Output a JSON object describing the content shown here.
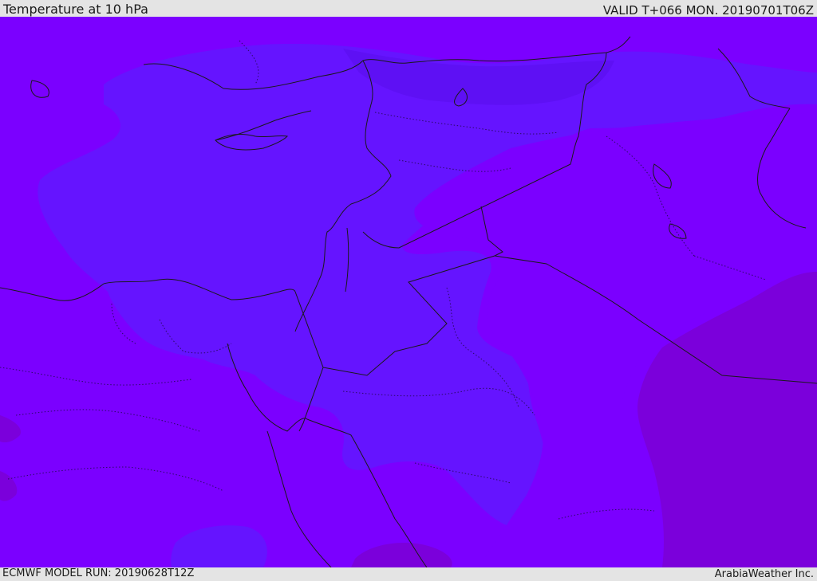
{
  "header": {
    "title": "Temperature at 10 hPa",
    "valid_time": "VALID T+066 MON. 20190701T06Z"
  },
  "footer": {
    "model_run": "ECMWF MODEL RUN: 20190628T12Z",
    "credit": "ArabiaWeather Inc."
  },
  "map": {
    "variable": "temperature",
    "level": "10 hPa",
    "region": "Eastern Mediterranean / Middle East",
    "color_bands": [
      {
        "name": "violet",
        "color": "#7b00ff"
      },
      {
        "name": "blue-violet",
        "color": "#6514ff"
      },
      {
        "name": "indigo",
        "color": "#5e10f4"
      },
      {
        "name": "dark-violet",
        "color": "#7b00db"
      }
    ],
    "boundary_color": "#1a1a1a"
  }
}
